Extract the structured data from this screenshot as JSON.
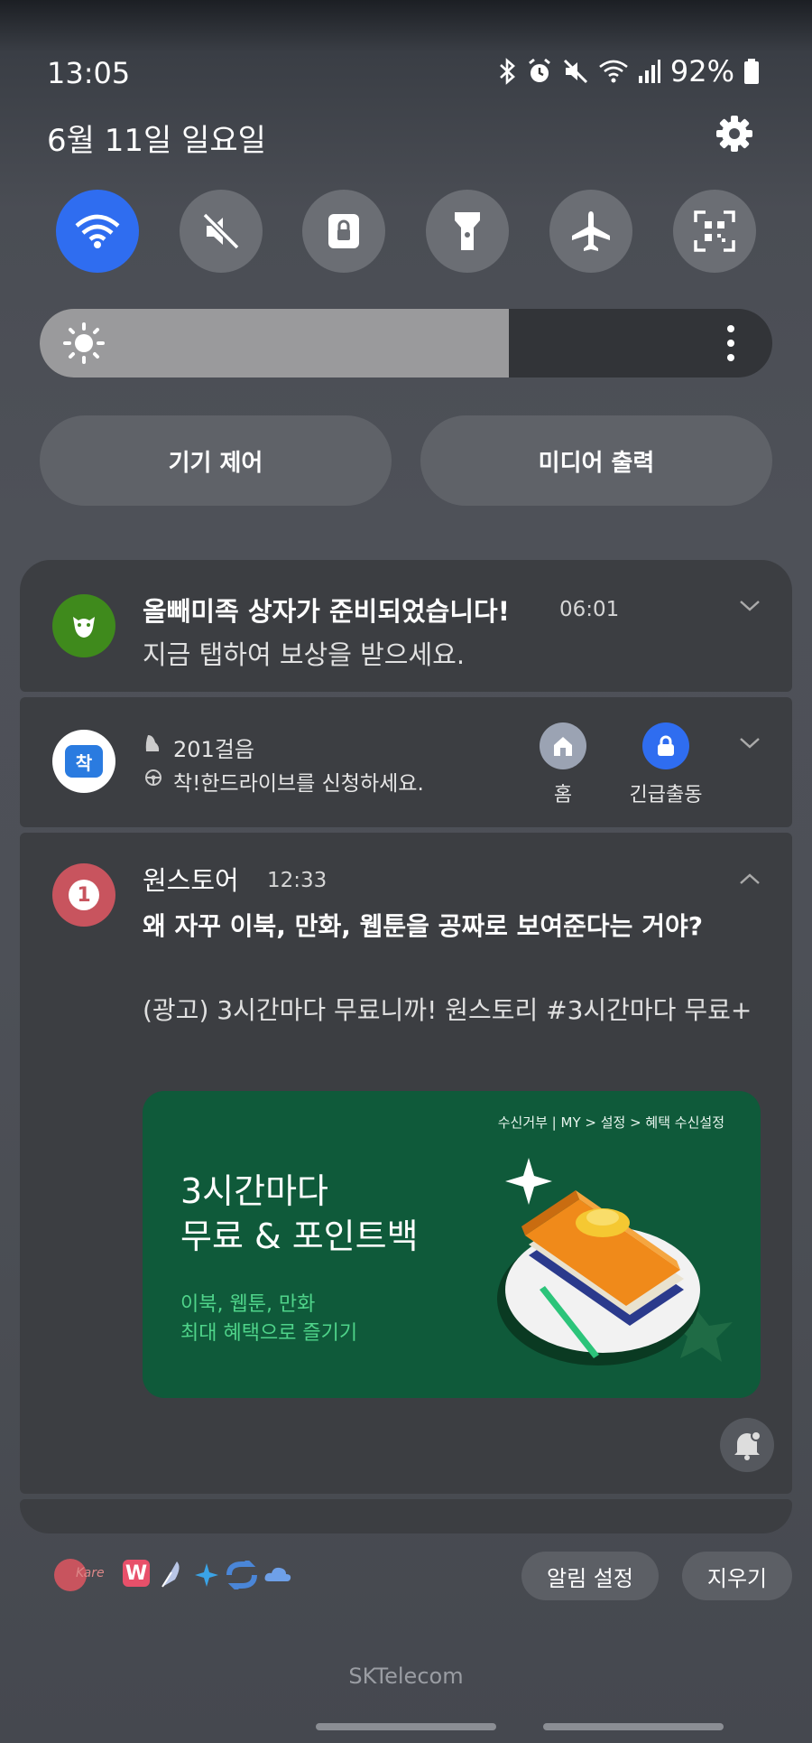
{
  "status": {
    "time": "13:05",
    "battery": "92%"
  },
  "date": "6월 11일 일요일",
  "brightness_level": 0.64,
  "controls": {
    "device_control": "기기 제어",
    "media_output": "미디어 출력"
  },
  "notifications": [
    {
      "title": "올빼미족 상자가 준비되었습니다!",
      "time": "06:01",
      "text": "지금 탭하여 보상을 받으세요."
    },
    {
      "steps": "201걸음",
      "text": "착!한드라이브를 신청하세요.",
      "icon_label": "착",
      "action_home": "홈",
      "action_emergency": "긴급출동"
    },
    {
      "app": "원스토어",
      "time": "12:33",
      "title": "왜 자꾸 이북, 만화, 웹툰을 공짜로 보여준다는 거야?",
      "body": "(광고) 3시간마다 무료니까! 원스토리 #3시간마다 무료+",
      "banner": {
        "opt_out": "수신거부 | MY > 설정 > 혜택 수신설정",
        "headline_1": "3시간마다",
        "headline_2": "무료 & 포인트백",
        "sub_1": "이북, 웹툰, 만화",
        "sub_2": "최대 혜택으로 즐기기"
      }
    }
  ],
  "bottom": {
    "notif_settings": "알림 설정",
    "clear": "지우기"
  },
  "carrier": "SKTelecom",
  "colors": {
    "accent": "#2f6df0",
    "banner_bg": "#0f5a3a"
  }
}
